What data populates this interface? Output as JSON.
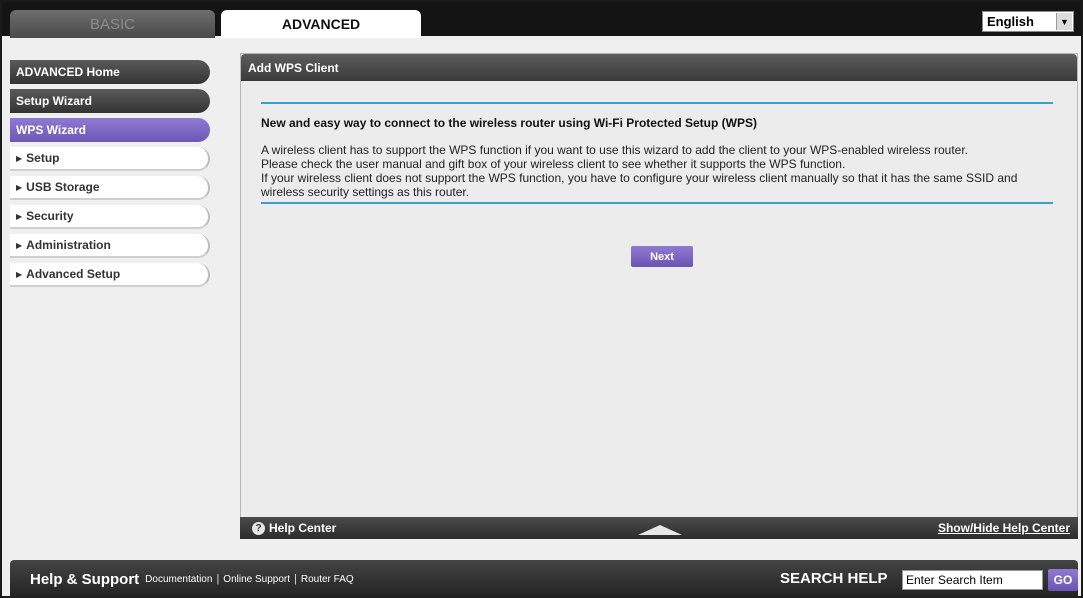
{
  "tabs": {
    "basic": "BASIC",
    "advanced": "ADVANCED"
  },
  "language": {
    "selected": "English"
  },
  "sidebar": {
    "items": [
      {
        "label": "ADVANCED Home",
        "style": "dark"
      },
      {
        "label": "Setup Wizard",
        "style": "dark"
      },
      {
        "label": "WPS Wizard",
        "style": "active"
      },
      {
        "label": "Setup",
        "style": "light"
      },
      {
        "label": "USB Storage",
        "style": "light"
      },
      {
        "label": "Security",
        "style": "light"
      },
      {
        "label": "Administration",
        "style": "light"
      },
      {
        "label": "Advanced Setup",
        "style": "light"
      }
    ]
  },
  "main": {
    "header": "Add WPS Client",
    "heading": "New and easy way to connect to the wireless router using Wi-Fi Protected Setup (WPS)",
    "paragraphs": [
      "A wireless client has to support the WPS function if you want to use this wizard to add the client to your WPS-enabled wireless router.",
      "Please check the user manual and gift box of your wireless client to see whether it supports the WPS function.",
      "If your wireless client does not support the WPS function, you have to configure your wireless client manually so that it has the same SSID and wireless security settings as this router."
    ],
    "next_label": "Next"
  },
  "help_center": {
    "label": "Help Center",
    "toggle": "Show/Hide Help Center"
  },
  "footer": {
    "title": "Help & Support",
    "links": [
      "Documentation",
      "Online Support",
      "Router FAQ"
    ],
    "search_label": "SEARCH HELP",
    "search_placeholder": "Enter Search Item",
    "go_label": "GO"
  },
  "colors": {
    "accent_purple": "#7b66c4",
    "rule_blue": "#3b9fcf",
    "dark_bar": "#141414"
  }
}
